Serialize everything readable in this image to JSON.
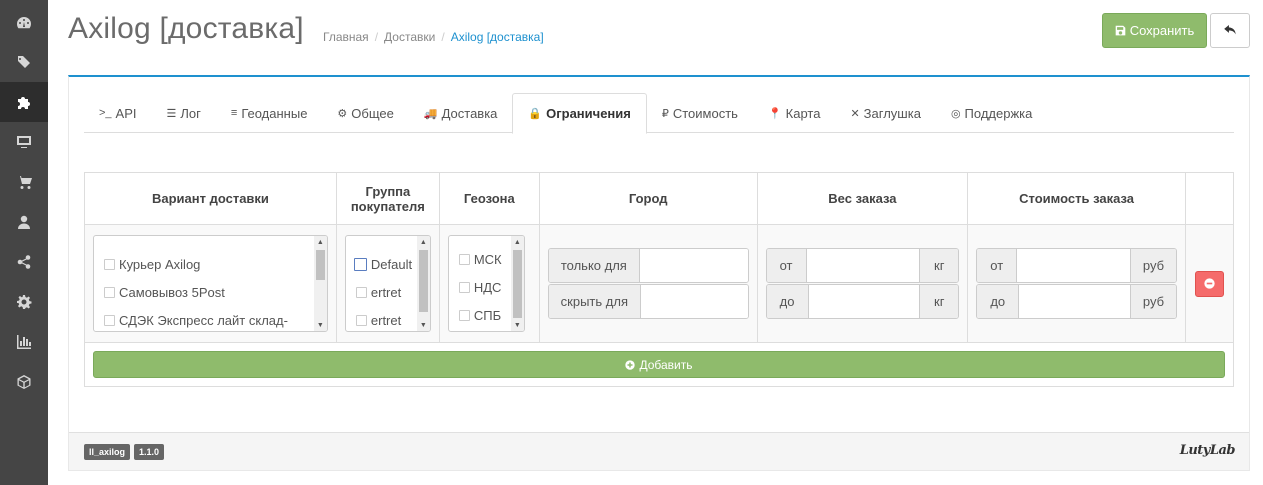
{
  "sidebar": {
    "items": [
      {
        "icon": "dashboard-icon"
      },
      {
        "icon": "tags-icon"
      },
      {
        "icon": "puzzle-icon",
        "active": true
      },
      {
        "icon": "monitor-icon"
      },
      {
        "icon": "cart-icon"
      },
      {
        "icon": "user-icon"
      },
      {
        "icon": "share-icon"
      },
      {
        "icon": "gear-icon"
      },
      {
        "icon": "bar-chart-icon"
      },
      {
        "icon": "cube-icon"
      }
    ]
  },
  "header": {
    "title": "Axilog [доставка]",
    "breadcrumb": [
      "Главная",
      "Доставки",
      "Axilog [доставка]"
    ],
    "save_label": "Сохранить"
  },
  "tabs": [
    {
      "icon": ">_",
      "label": "API"
    },
    {
      "icon": "☰",
      "label": "Лог"
    },
    {
      "icon": "≡",
      "label": "Геоданные"
    },
    {
      "icon": "⚙",
      "label": "Общее"
    },
    {
      "icon": "🚚",
      "label": "Доставка"
    },
    {
      "icon": "🔒",
      "label": "Ограничения",
      "active": true
    },
    {
      "icon": "₽",
      "label": "Стоимость"
    },
    {
      "icon": "📍",
      "label": "Карта"
    },
    {
      "icon": "✕",
      "label": "Заглушка"
    },
    {
      "icon": "◎",
      "label": "Поддержка"
    }
  ],
  "table": {
    "headers": {
      "delivery": "Вариант доставки",
      "group_line1": "Группа",
      "group_line2": "покупателя",
      "geozone": "Геозона",
      "city": "Город",
      "weight": "Вес заказа",
      "cost": "Стоимость заказа"
    },
    "delivery_options": [
      "Курьер Axilog",
      "Самовывоз 5Post",
      "СДЭК Экспресс лайт склад-"
    ],
    "group_options": [
      "Default",
      "ertret",
      "ertret"
    ],
    "geozone_options": [
      "МСК",
      "НДС",
      "СПБ"
    ],
    "city": {
      "only_for": "только для",
      "hide_for": "скрыть для"
    },
    "weight": {
      "from": "от",
      "to": "до",
      "unit": "кг"
    },
    "cost": {
      "from": "от",
      "to": "до",
      "unit": "руб"
    },
    "add_label": "Добавить"
  },
  "footer": {
    "module_code": "ll_axilog",
    "version": "1.1.0",
    "brand": "LutyLab"
  },
  "colors": {
    "sidebar_bg": "#454545",
    "accent_blue": "#1e91cf",
    "success_green": "#8fbb6c",
    "danger_red": "#f56b6b"
  }
}
